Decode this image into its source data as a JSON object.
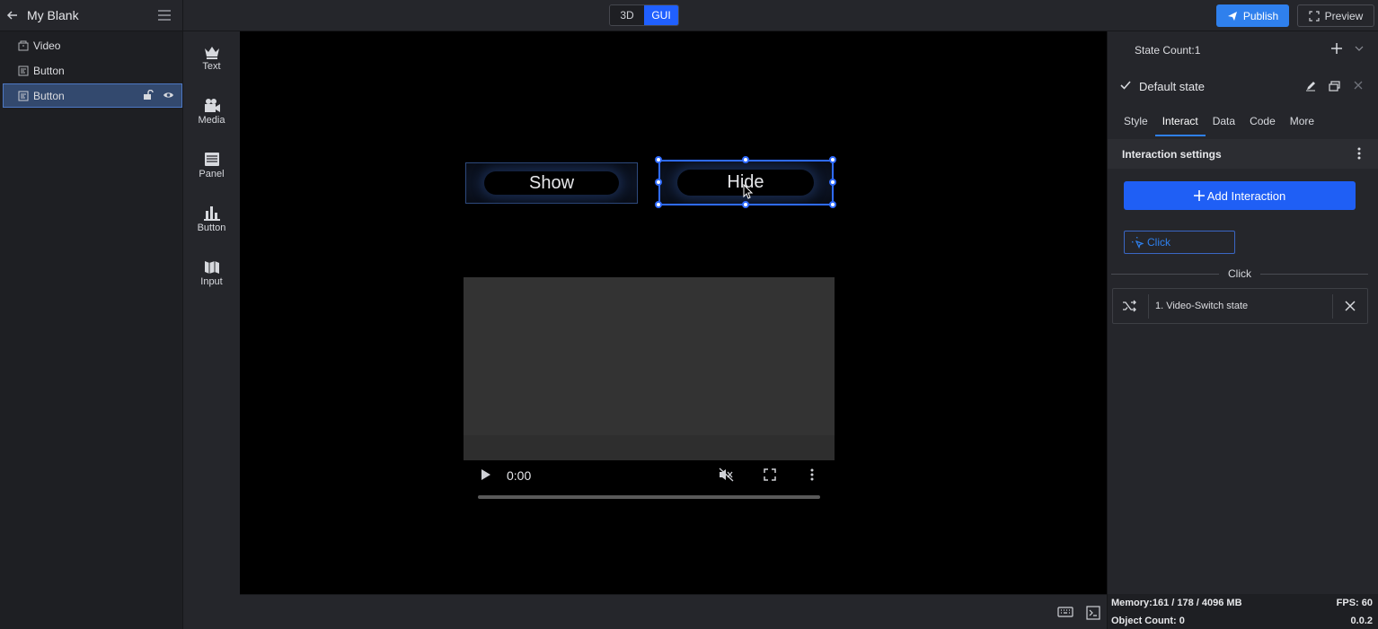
{
  "header": {
    "project_title": "My Blank",
    "mode_3d": "3D",
    "mode_gui": "GUI",
    "active_mode": "GUI",
    "publish_label": "Publish",
    "preview_label": "Preview",
    "accent_color": "#2060ff"
  },
  "layers": {
    "items": [
      {
        "label": "Video",
        "icon": "group-icon"
      },
      {
        "label": "Button",
        "icon": "button-layer-icon"
      },
      {
        "label": "Button",
        "icon": "button-layer-icon",
        "selected": true
      }
    ]
  },
  "widgets": {
    "items": [
      {
        "label": "Text",
        "icon": "crown-text-icon"
      },
      {
        "label": "Media",
        "icon": "video-camera-icon"
      },
      {
        "label": "Panel",
        "icon": "panel-icon"
      },
      {
        "label": "Button",
        "icon": "bar-chart-icon"
      },
      {
        "label": "Input",
        "icon": "map-icon"
      }
    ]
  },
  "canvas": {
    "show_button": "Show",
    "hide_button": "Hide",
    "video_time": "0:00"
  },
  "props": {
    "state_count": "State Count:1",
    "state_name": "Default state",
    "tabs": [
      "Style",
      "Interact",
      "Data",
      "Code",
      "More"
    ],
    "active_tab": "Interact",
    "section_title": "Interaction settings",
    "add_interaction": "Add Interaction",
    "trigger": "Click",
    "divider_label": "Click",
    "action_text": "1. Video-Switch state"
  },
  "footer": {
    "memory": "Memory:161 / 178 / 4096 MB",
    "fps": "FPS: 60",
    "object_count": "Object Count: 0",
    "version": "0.0.2"
  }
}
